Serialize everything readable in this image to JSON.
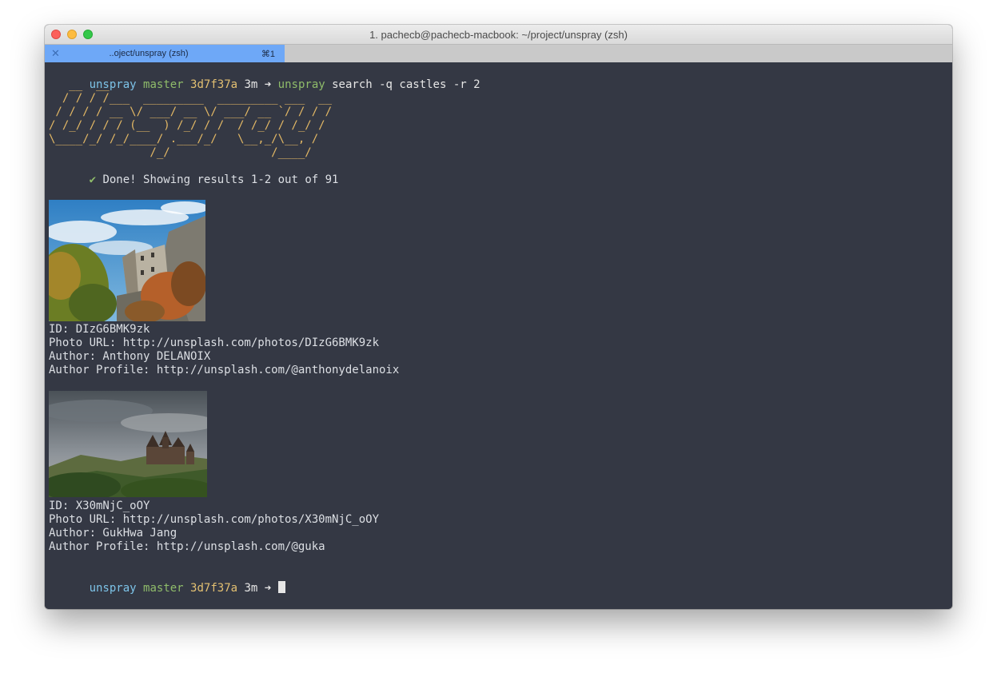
{
  "window": {
    "title": "1. pachecb@pachecb-macbook: ~/project/unspray (zsh)"
  },
  "tab": {
    "close_glyph": "✕",
    "label": "..oject/unspray (zsh)",
    "shortcut": "⌘1"
  },
  "prompt1": {
    "dir": "unspray",
    "branch": "master",
    "commit": "3d7f37a",
    "age": "3m",
    "arrow": "➜",
    "cmd": "unspray",
    "args": "search -q castles -r 2"
  },
  "ascii_art": [
    "   __  __",
    "  / / / /___  _________  _________ ___  __",
    " / / / / __ \\/ ___/ __ \\/ ___/ __ `/ / / /",
    "/ /_/ / / / (__  ) /_/ / /  / /_/ / /_/ /",
    "\\____/_/ /_/____/ .___/_/   \\__,_/\\__, /",
    "               /_/               /____/"
  ],
  "status": {
    "check": "✔",
    "message": "Done! Showing results 1-2 out of 91"
  },
  "results": [
    {
      "id_line": "ID: DIzG6BMK9zk",
      "url_line": "Photo URL: http://unsplash.com/photos/DIzG6BMK9zk",
      "author_line": "Author: Anthony DELANOIX",
      "profile_line": "Author Profile: http://unsplash.com/@anthonydelanoix"
    },
    {
      "id_line": "ID: X30mNjC_oOY",
      "url_line": "Photo URL: http://unsplash.com/photos/X30mNjC_oOY",
      "author_line": "Author: GukHwa Jang",
      "profile_line": "Author Profile: http://unsplash.com/@guka"
    }
  ],
  "prompt2": {
    "dir": "unspray",
    "branch": "master",
    "commit": "3d7f37a",
    "age": "3m",
    "arrow": "➜"
  }
}
